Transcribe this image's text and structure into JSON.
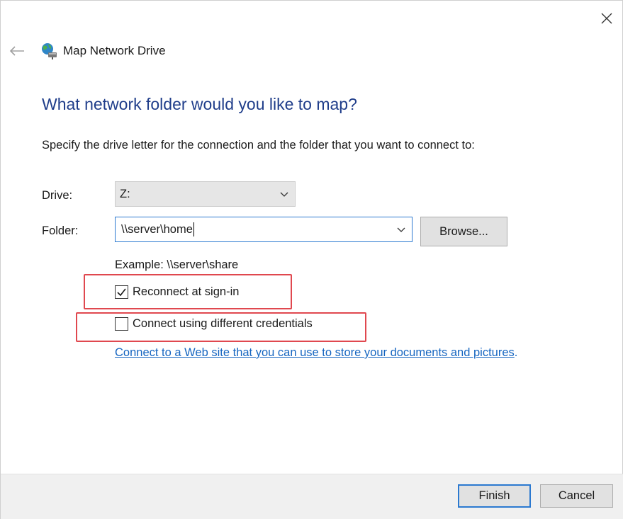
{
  "window": {
    "title": "Map Network Drive"
  },
  "heading": "What network folder would you like to map?",
  "instruction": "Specify the drive letter for the connection and the folder that you want to connect to:",
  "drive": {
    "label": "Drive:",
    "value": "Z:"
  },
  "folder": {
    "label": "Folder:",
    "value": "\\\\server\\home",
    "browse_label": "Browse..."
  },
  "example": "Example: \\\\server\\share",
  "options": {
    "reconnect": {
      "label": "Reconnect at sign-in",
      "checked": true
    },
    "credentials": {
      "label": "Connect using different credentials",
      "checked": false
    }
  },
  "web_link": {
    "text": "Connect to a Web site that you can use to store your documents and pictures",
    "suffix": "."
  },
  "footer": {
    "finish_label": "Finish",
    "cancel_label": "Cancel"
  },
  "colors": {
    "heading": "#1f3d8a",
    "link": "#1565c0",
    "highlight": "#e0484f",
    "focus_border": "#2b79d0"
  },
  "icons": {
    "title": "network-drive-icon",
    "back": "back-arrow-icon",
    "close": "close-icon",
    "dropdown": "chevron-down-icon",
    "check": "checkmark-icon"
  }
}
